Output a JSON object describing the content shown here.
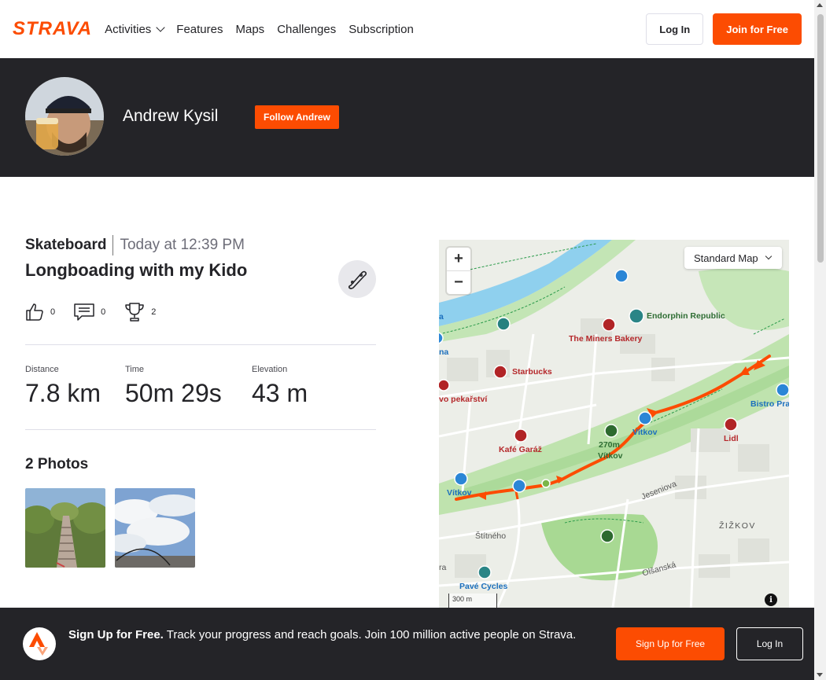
{
  "nav": {
    "logo": "STRAVA",
    "items": [
      {
        "label": "Activities"
      },
      {
        "label": "Features"
      },
      {
        "label": "Maps"
      },
      {
        "label": "Challenges"
      },
      {
        "label": "Subscription"
      }
    ],
    "login_label": "Log In",
    "join_label": "Join for Free"
  },
  "athlete": {
    "name": "Andrew Kysil",
    "follow_label": "Follow Andrew"
  },
  "activity": {
    "sport": "Skateboard",
    "date": "Today at 12:39 PM",
    "title": "Longboading with my Kido",
    "kudos": "0",
    "comments": "0",
    "achievements": "2",
    "stats": [
      {
        "label": "Distance",
        "value": "7.8 km"
      },
      {
        "label": "Time",
        "value": "50m 29s"
      },
      {
        "label": "Elevation",
        "value": "43 m"
      }
    ],
    "photos_heading": "2 Photos"
  },
  "map": {
    "style_label": "Standard Map",
    "zoom_in": "+",
    "zoom_out": "−",
    "scale": "300 m",
    "info": "i",
    "labels": {
      "endorphin": "Endorphin Republic",
      "miners": "The Miners Bakery",
      "starbucks": "Starbucks",
      "pekarstvi": "vo pekařství",
      "bistro": "Bistro Pra",
      "vitkov1": "Vítkov",
      "elev": "270m",
      "vitkov2": "Vítkov",
      "lidl": "Lidl",
      "kafe": "Kafé Garáž",
      "vitkov3": "Vítkov",
      "jeseniova": "Jeseniova",
      "zizkov": "ŽIŽKOV",
      "stitneho": "Štítného",
      "olsanska": "Olšanská",
      "pave": "Pavé Cycles",
      "edge_a": "a",
      "edge_na": "na",
      "edge_ra": "ra"
    }
  },
  "cta": {
    "bold": "Sign Up for Free.",
    "text": " Track your progress and reach goals. Join 100 million active people on Strava.",
    "signup_label": "Sign Up for Free",
    "login_label": "Log In"
  },
  "colors": {
    "brand": "#fc4c02",
    "dark": "#242428",
    "route": "#fc4c02"
  }
}
